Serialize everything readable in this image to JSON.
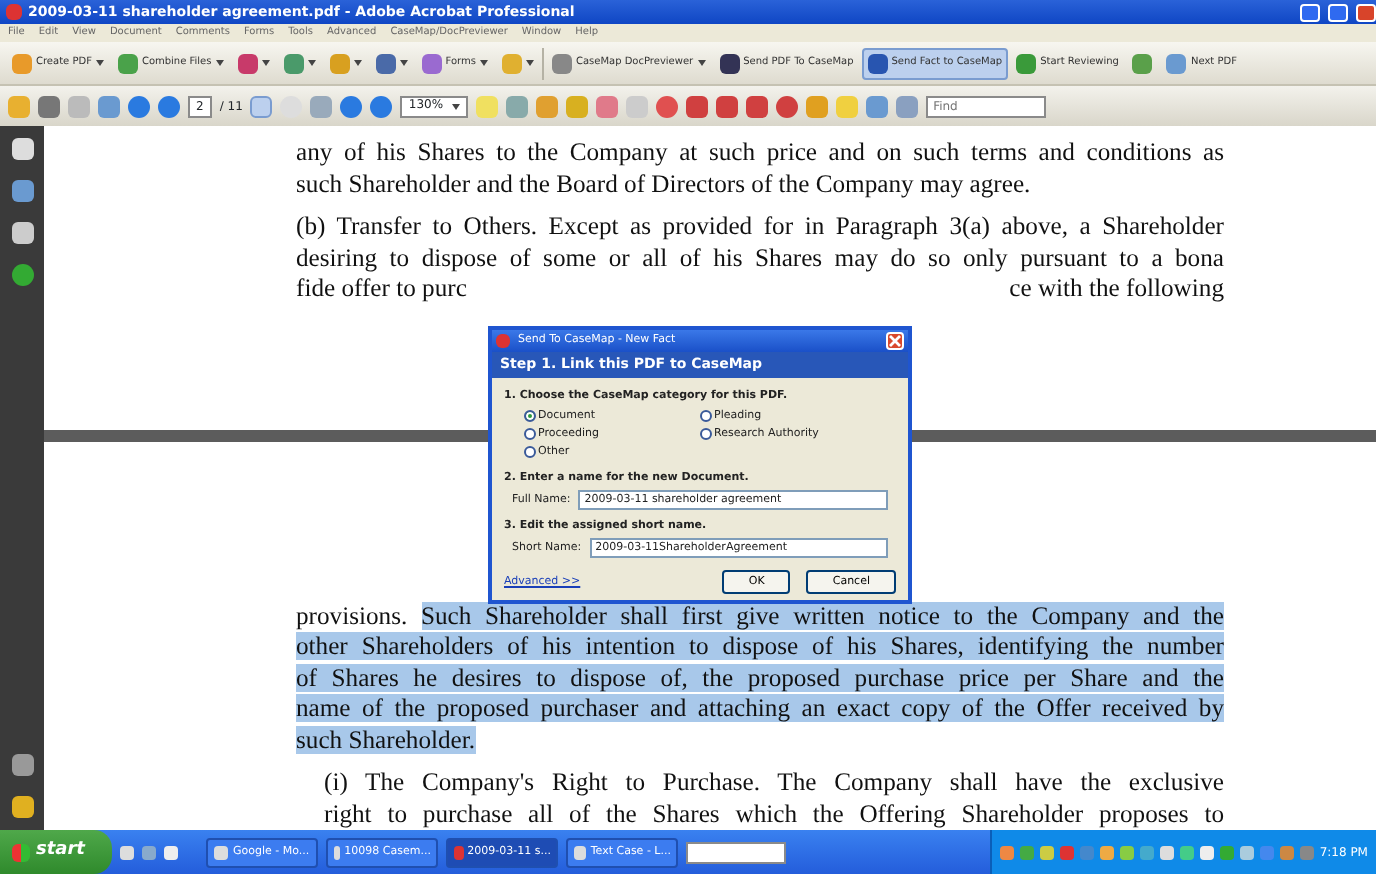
{
  "window": {
    "title": "2009-03-11 shareholder agreement.pdf - Adobe Acrobat Professional"
  },
  "menu": [
    "File",
    "Edit",
    "View",
    "Document",
    "Comments",
    "Forms",
    "Tools",
    "Advanced",
    "CaseMap/DocPreviewer",
    "Window",
    "Help"
  ],
  "toolbar": [
    {
      "label": "Create PDF",
      "dropdown": true,
      "selected": false
    },
    {
      "label": "Combine Files",
      "dropdown": true,
      "selected": false
    },
    {
      "dropdown": true,
      "selected": false
    },
    {
      "dropdown": true,
      "selected": false
    },
    {
      "dropdown": true,
      "selected": false
    },
    {
      "dropdown": true,
      "selected": false
    },
    {
      "label": "Forms",
      "dropdown": true,
      "selected": false
    },
    {
      "dropdown": true,
      "selected": false
    },
    {
      "label": "CaseMap DocPreviewer",
      "dropdown": true,
      "selected": false
    },
    {
      "label": "Send PDF To CaseMap",
      "dropdown": false,
      "selected": false
    },
    {
      "label": "Send Fact to CaseMap",
      "dropdown": false,
      "selected": true
    },
    {
      "label": "Start Reviewing",
      "dropdown": false,
      "selected": false
    },
    {
      "dropdown": false,
      "selected": false
    },
    {
      "label": "Next PDF",
      "dropdown": false,
      "selected": false
    }
  ],
  "navigation": {
    "page": "2",
    "page_count": "/ 11",
    "zoom": "130%",
    "find_placeholder": "Find"
  },
  "pages": [
    {
      "lines": [
        {
          "kind": "text",
          "justify": true,
          "segments": [
            {
              "text": "any of his Shares to the Company at such price and on such terms and conditions as",
              "highlighted": false
            }
          ]
        },
        {
          "kind": "text",
          "justify": false,
          "segments": [
            {
              "text": "such Shareholder and the Board of Directors of the Company may agree.",
              "highlighted": false
            }
          ]
        },
        {
          "kind": "gap"
        },
        {
          "kind": "text",
          "justify": true,
          "segments": [
            {
              "text": "(b) Transfer to Others. Except as provided for in Paragraph 3(a) above, a Shareholder",
              "highlighted": false
            }
          ]
        },
        {
          "kind": "text",
          "justify": true,
          "segments": [
            {
              "text": "desiring to dispose of some or all of his Shares may do so only pursuant to a bona",
              "highlighted": false
            }
          ]
        },
        {
          "kind": "split",
          "left": "fide offer to purc",
          "right": "ce with the following"
        }
      ]
    },
    {
      "lines": [
        {
          "kind": "text",
          "justify": true,
          "segments": [
            {
              "text": "provisions. ",
              "highlighted": false
            },
            {
              "text": "Such Shareholder shall first give written notice to the Company and the",
              "highlighted": true
            }
          ]
        },
        {
          "kind": "text",
          "justify": true,
          "segments": [
            {
              "text": "other Shareholders of his intention to dispose of his Shares, identifying the number",
              "highlighted": true
            }
          ]
        },
        {
          "kind": "text",
          "justify": true,
          "segments": [
            {
              "text": "of Shares he desires to dispose of, the proposed purchase price per Share and the",
              "highlighted": true
            }
          ]
        },
        {
          "kind": "text",
          "justify": true,
          "segments": [
            {
              "text": "name of the proposed purchaser and attaching an exact copy of the Offer received by",
              "highlighted": true
            }
          ]
        },
        {
          "kind": "text",
          "justify": false,
          "segments": [
            {
              "text": "such Shareholder.",
              "highlighted": true
            }
          ]
        },
        {
          "kind": "gap"
        },
        {
          "kind": "text",
          "justify": true,
          "indent": true,
          "segments": [
            {
              "text": "(i) The Company's Right to Purchase.  The Company shall have the exclusive",
              "highlighted": false
            }
          ]
        },
        {
          "kind": "text",
          "justify": true,
          "indent": true,
          "segments": [
            {
              "text": "right to purchase all  of the Shares which the Offering Shareholder proposes to",
              "highlighted": false
            }
          ]
        }
      ]
    }
  ],
  "dialog": {
    "title": "Send To CaseMap - New Fact",
    "step": "Step 1. Link this PDF to CaseMap",
    "category_prompt": "1. Choose the CaseMap category for this PDF.",
    "categories": [
      {
        "label": "Document",
        "selected": true
      },
      {
        "label": "Pleading",
        "selected": false
      },
      {
        "label": "Proceeding",
        "selected": false
      },
      {
        "label": "Research Authority",
        "selected": false
      },
      {
        "label": "Other",
        "selected": false
      }
    ],
    "name_prompt": "2. Enter a name for the new Document.",
    "full_name": {
      "label": "Full Name:",
      "value": "2009-03-11 shareholder agreement"
    },
    "short_prompt": "3. Edit the assigned short name.",
    "short_name": {
      "label": "Short Name:",
      "value": "2009-03-11ShareholderAgreement"
    },
    "advanced": "Advanced >>",
    "buttons": [
      "OK",
      "Cancel"
    ]
  },
  "taskbar": {
    "start": "start",
    "tasks": [
      {
        "label": "Google - Mo...",
        "selected": false
      },
      {
        "label": "10098 Casem...",
        "selected": false
      },
      {
        "label": "2009-03-11 s...",
        "selected": true
      },
      {
        "label": "Text Case - L...",
        "selected": false
      }
    ],
    "clock": "7:18 PM"
  }
}
